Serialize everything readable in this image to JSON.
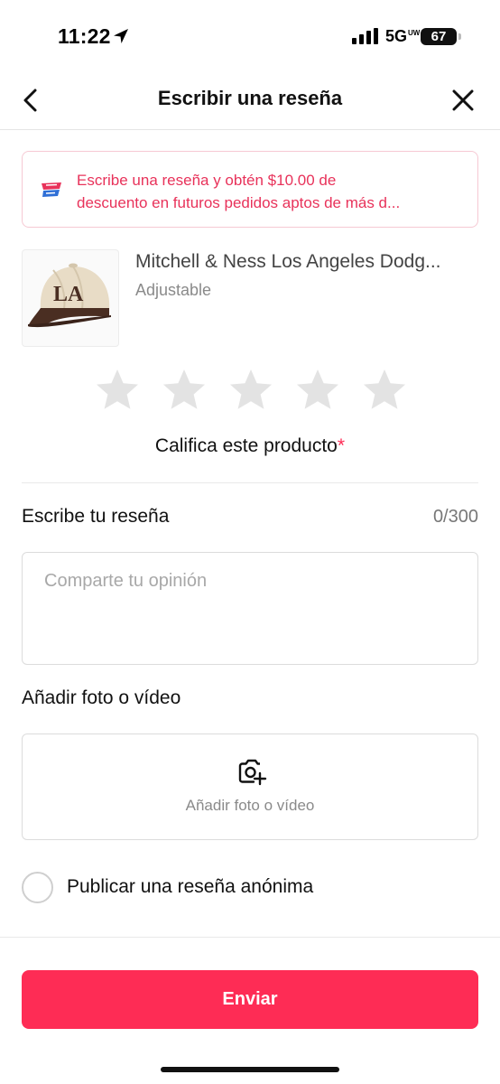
{
  "status_bar": {
    "time": "11:22",
    "network": "5G",
    "network_suffix": "UW",
    "battery": "67"
  },
  "header": {
    "title": "Escribir una reseña"
  },
  "promo": {
    "line1": "Escribe una reseña y obtén $10.00 de",
    "line2": "descuento en futuros pedidos aptos de más d...",
    "accent_color": "#e8325a"
  },
  "product": {
    "name": "Mitchell & Ness Los Angeles Dodg...",
    "variant": "Adjustable"
  },
  "rating": {
    "stars_total": 5,
    "stars_selected": 0,
    "label": "Califica este producto",
    "required_mark": "*"
  },
  "review": {
    "label": "Escribe tu reseña",
    "count": "0/300",
    "value": "",
    "placeholder": "Comparte tu opinión"
  },
  "media": {
    "label": "Añadir foto o vídeo",
    "button_label": "Añadir foto o vídeo",
    "icon": "camera-plus-icon"
  },
  "anonymous": {
    "label": "Publicar una reseña anónima",
    "checked": false
  },
  "submit": {
    "label": "Enviar",
    "color": "#fe2c55"
  }
}
